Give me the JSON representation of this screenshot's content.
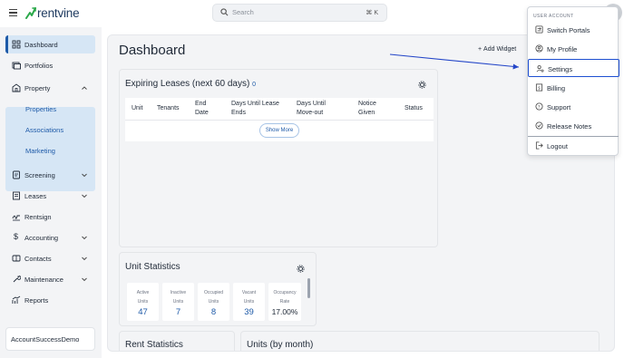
{
  "topbar": {
    "logo_text": "rentvine",
    "search_placeholder": "Search",
    "search_shortcut": "⌘ K"
  },
  "sidebar": {
    "items": {
      "dashboard": "Dashboard",
      "portfolios": "Portfolios",
      "property": "Property",
      "screening": "Screening",
      "leases": "Leases",
      "rentsign": "Rentsign",
      "accounting": "Accounting",
      "contacts": "Contacts",
      "maintenance": "Maintenance",
      "reports": "Reports"
    },
    "property_sub": {
      "properties": "Properties",
      "associations": "Associations",
      "marketing": "Marketing"
    },
    "account_name": "AccountSuccessDemo"
  },
  "main": {
    "title": "Dashboard",
    "add_widget": "Add Widget",
    "expiring": {
      "title": "Expiring Leases (next 60 days)",
      "count": "0",
      "columns": {
        "unit": "Unit",
        "tenants": "Tenants",
        "end_date_1": "End",
        "end_date_2": "Date",
        "days_until_end_1": "Days Until Lease",
        "days_until_end_2": "Ends",
        "days_until_move_1": "Days Until",
        "days_until_move_2": "Move-out",
        "notice_1": "Notice",
        "notice_2": "Given",
        "status": "Status"
      },
      "show_more": "Show More"
    },
    "unit_stats": {
      "title": "Unit Statistics",
      "stats": {
        "active": {
          "line1": "Active",
          "line2": "Units",
          "value": "47"
        },
        "inactive": {
          "line1": "Inactive",
          "line2": "Units",
          "value": "7"
        },
        "occupied": {
          "line1": "Occupied",
          "line2": "Units",
          "value": "8"
        },
        "vacant": {
          "line1": "Vacant",
          "line2": "Units",
          "value": "39"
        },
        "occupancy": {
          "line1": "Occupancy",
          "line2": "Rate",
          "value": "17.00%"
        }
      }
    },
    "bottom_cards": {
      "rent": "Rent Statistics",
      "units": "Units (by month)"
    }
  },
  "dropdown": {
    "header": "USER ACCOUNT",
    "items": {
      "switch_portals": "Switch Portals",
      "my_profile": "My Profile",
      "settings": "Settings",
      "billing": "Billing",
      "support": "Support",
      "release_notes": "Release Notes",
      "logout": "Logout"
    }
  },
  "colors": {
    "accent": "#1e5aa8",
    "active_bg": "#d6e6f5",
    "highlight_border": "#1e4fd1",
    "annotation_arrow": "#2446c8"
  }
}
